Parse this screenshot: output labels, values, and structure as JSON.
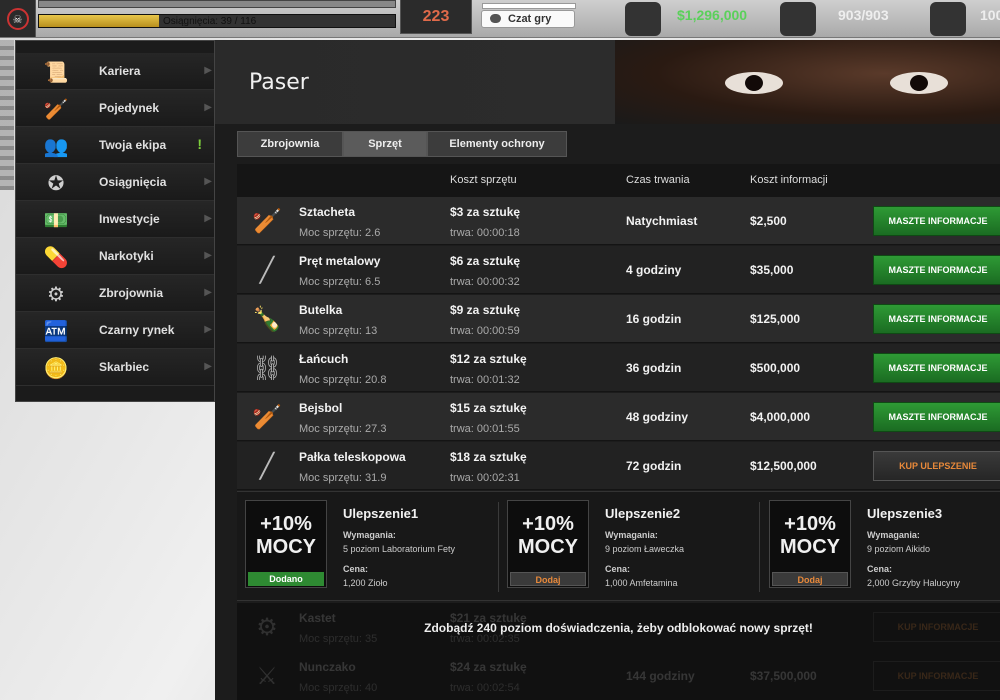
{
  "topbar": {
    "xp_text": "Osiągnięcia: 39 / 116",
    "xp_fraction": 0.336,
    "energy_value": "223",
    "chat_label": "Czat gry",
    "money": "$1,296,000",
    "stamina": "903/903",
    "health": "100"
  },
  "sidebar": {
    "items": [
      {
        "label": "Kariera",
        "icon": "scroll-icon"
      },
      {
        "label": "Pojedynek",
        "icon": "bat-icon"
      },
      {
        "label": "Twoja ekipa",
        "icon": "crew-icon",
        "alert": "!"
      },
      {
        "label": "Osiągnięcia",
        "icon": "wreath-icon"
      },
      {
        "label": "Inwestycje",
        "icon": "money-icon"
      },
      {
        "label": "Narkotyki",
        "icon": "pills-icon"
      },
      {
        "label": "Zbrojownia",
        "icon": "brass-knuckles-icon"
      },
      {
        "label": "Czarny rynek",
        "icon": "cash-register-icon"
      },
      {
        "label": "Skarbiec",
        "icon": "coins-icon"
      }
    ]
  },
  "header": {
    "title": "Paser"
  },
  "tabs": [
    "Zbrojownia",
    "Sprzęt",
    "Elementy ochrony"
  ],
  "active_tab": "Sprzęt",
  "table": {
    "headers": [
      "Koszt sprzętu",
      "Czas trwania",
      "Koszt informacji"
    ],
    "rows": [
      {
        "name": "Sztacheta",
        "power": "Moc sprzętu: 2.6",
        "price": "$3 za sztukę",
        "duration": "trwa: 00:00:18",
        "time": "Natychmiast",
        "cost": "$2,500",
        "action": "MASZTE INFORMACJE",
        "action_type": "green"
      },
      {
        "name": "Pręt metalowy",
        "power": "Moc sprzętu: 6.5",
        "price": "$6 za sztukę",
        "duration": "trwa: 00:00:32",
        "time": "4 godziny",
        "cost": "$35,000",
        "action": "MASZTE INFORMACJE",
        "action_type": "green"
      },
      {
        "name": "Butelka",
        "power": "Moc sprzętu: 13",
        "price": "$9 za sztukę",
        "duration": "trwa: 00:00:59",
        "time": "16 godzin",
        "cost": "$125,000",
        "action": "MASZTE INFORMACJE",
        "action_type": "green"
      },
      {
        "name": "Łańcuch",
        "power": "Moc sprzętu: 20.8",
        "price": "$12 za sztukę",
        "duration": "trwa: 00:01:32",
        "time": "36 godzin",
        "cost": "$500,000",
        "action": "MASZTE INFORMACJE",
        "action_type": "green"
      },
      {
        "name": "Bejsbol",
        "power": "Moc sprzętu: 27.3",
        "price": "$15 za sztukę",
        "duration": "trwa: 00:01:55",
        "time": "48 godziny",
        "cost": "$4,000,000",
        "action": "MASZTE INFORMACJE",
        "action_type": "green"
      },
      {
        "name": "Pałka teleskopowa",
        "power": "Moc sprzętu: 31.9",
        "price": "$18 za sztukę",
        "duration": "trwa: 00:02:31",
        "time": "72 godzin",
        "cost": "$12,500,000",
        "action": "KUP ULEPSZENIE",
        "action_type": "dark"
      }
    ]
  },
  "upgrades": [
    {
      "pct": "+10%",
      "mocy": "MOCY",
      "name": "Ulepszenie1",
      "req_label": "Wymagania:",
      "req": "5 poziom Laboratorium Fety",
      "cost_label": "Cena:",
      "cost": "1,200 Zioło",
      "button": "Dodano",
      "state": "done"
    },
    {
      "pct": "+10%",
      "mocy": "MOCY",
      "name": "Ulepszenie2",
      "req_label": "Wymagania:",
      "req": "9 poziom Ławeczka",
      "cost_label": "Cena:",
      "cost": "1,000 Amfetamina",
      "button": "Dodaj",
      "state": "todo"
    },
    {
      "pct": "+10%",
      "mocy": "MOCY",
      "name": "Ulepszenie3",
      "req_label": "Wymagania:",
      "req": "9 poziom Aikido",
      "cost_label": "Cena:",
      "cost": "2,000 Grzyby Halucyny",
      "button": "Dodaj",
      "state": "todo"
    }
  ],
  "locked": {
    "message": "Zdobądź 240 poziom doświadczenia, żeby odblokować nowy sprzęt!",
    "rows": [
      {
        "name": "Kastet",
        "power": "Moc sprzętu: 35",
        "price": "$21 za sztukę",
        "duration": "trwa: 00:02:35",
        "time": "",
        "cost": "",
        "action": "KUP INFORMACJE"
      },
      {
        "name": "Nunczako",
        "power": "Moc sprzętu: 40",
        "price": "$24 za sztukę",
        "duration": "trwa: 00:02:54",
        "time": "144 godziny",
        "cost": "$37,500,000",
        "action": "KUP INFORMACJE"
      }
    ]
  }
}
